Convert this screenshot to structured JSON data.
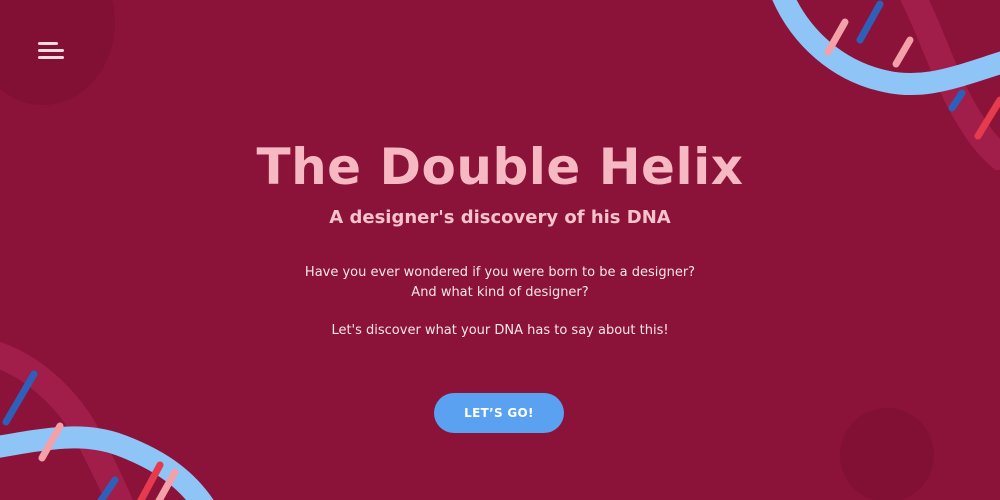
{
  "header": {
    "menu_icon": "hamburger-menu-icon"
  },
  "hero": {
    "title": "The Double Helix",
    "subtitle": "A designer's discovery of his DNA",
    "intro_line_1": "Have you ever wondered if you were born to be a designer?",
    "intro_line_2": "And what kind of designer?",
    "intro_line_3": "Let's discover what your DNA has to say about this!",
    "cta_label": "LET’S GO!"
  },
  "decorations": {
    "top_right_icon": "dna-helix-icon",
    "bottom_left_icon": "dna-helix-icon"
  },
  "colors": {
    "background": "#8b1239",
    "title": "#f6b8c2",
    "body_text": "#f7e6ea",
    "button": "#5aa1f2",
    "helix_light_blue": "#8fc4f7",
    "helix_dark_strand": "#a11e4b",
    "rung_blue": "#2f5fb8",
    "rung_pink": "#f4a0a8",
    "rung_red": "#e63a4e"
  }
}
